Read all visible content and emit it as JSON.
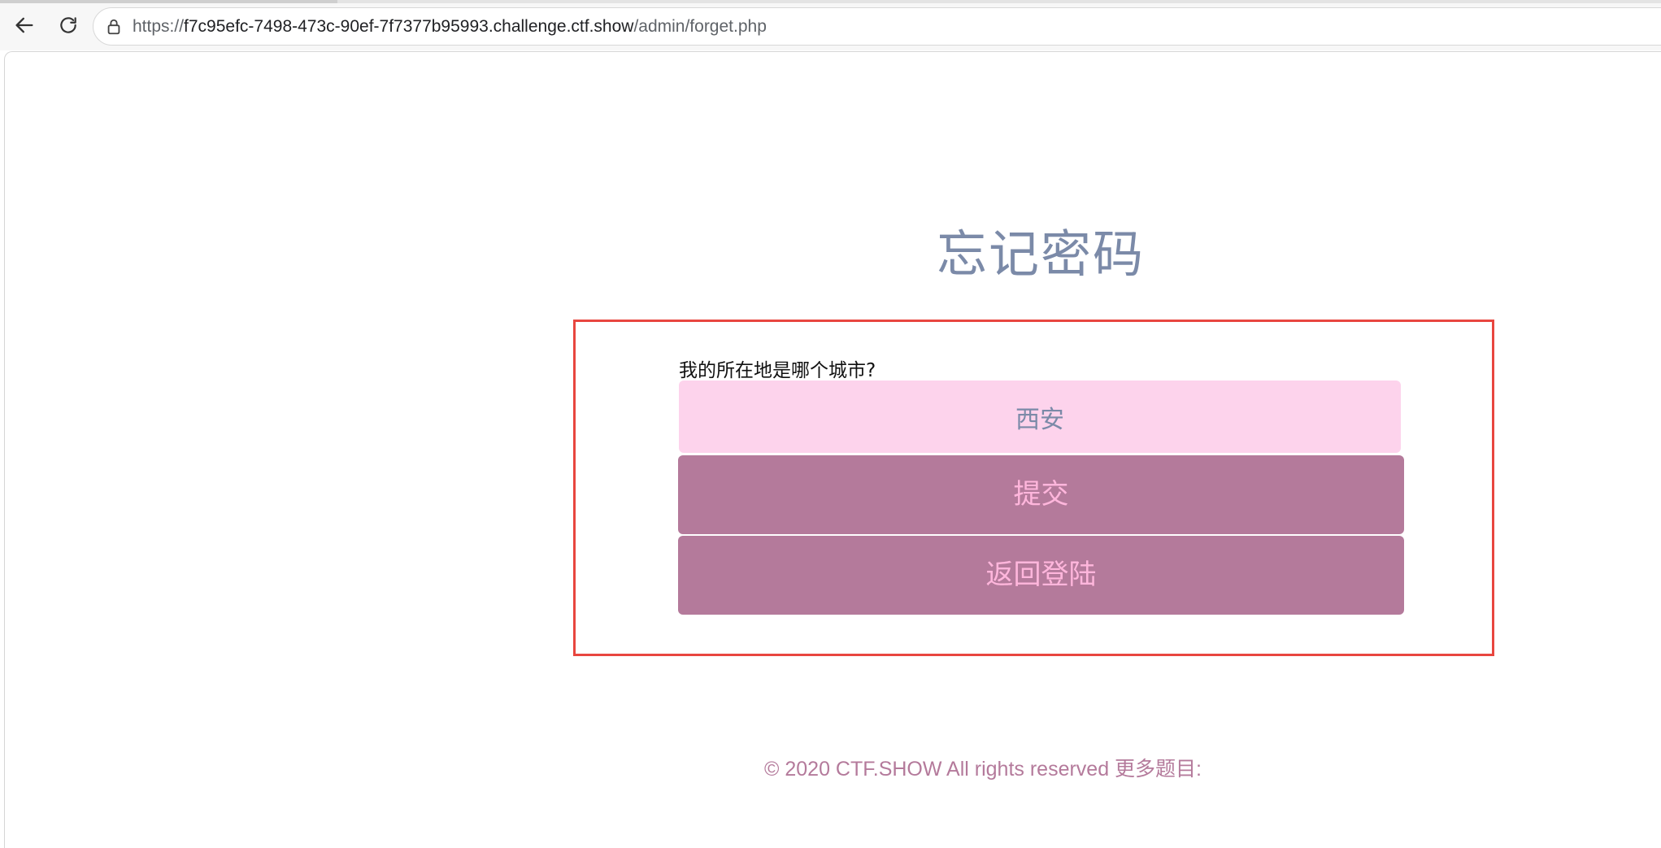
{
  "browser": {
    "url_prefix": "https://",
    "url_host": "f7c95efc-7498-473c-90ef-7f7377b95993.challenge.ctf.show",
    "url_path": "/admin/forget.php"
  },
  "page": {
    "title": "忘记密码",
    "question": "我的所在地是哪个城市?",
    "answer_value": "西安",
    "submit_label": "提交",
    "back_login_label": "返回登陆",
    "footer": "© 2020 CTF.SHOW All rights reserved 更多题目:"
  },
  "colors": {
    "title": "#7b8aa8",
    "input_bg": "#fdd3ec",
    "button_bg": "#b47a9b",
    "button_text": "#ffb6dc",
    "highlight_border": "#e8463f",
    "footer_text": "#b47a9b"
  }
}
